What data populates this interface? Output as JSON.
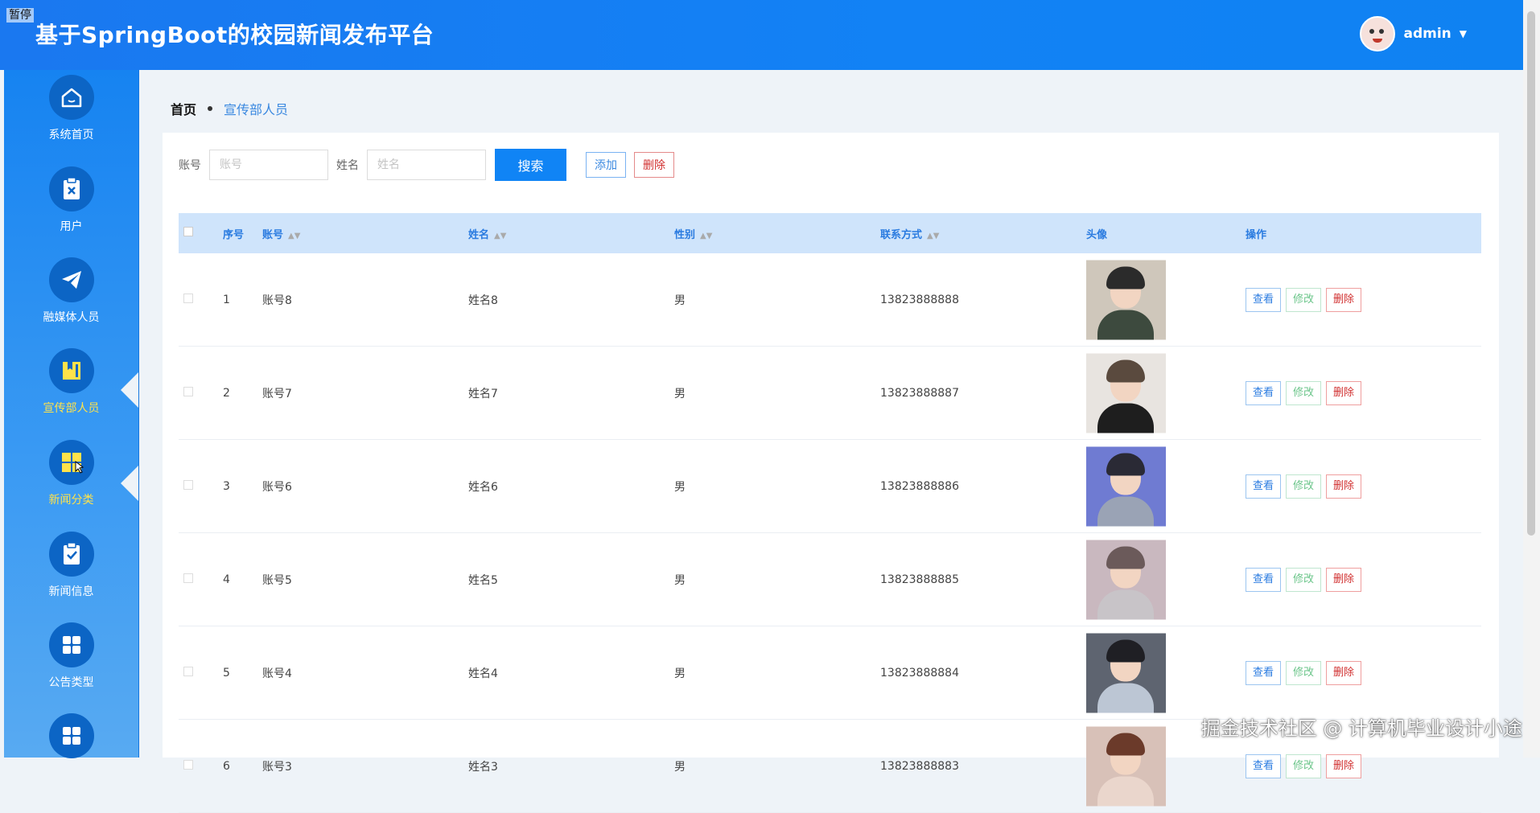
{
  "header": {
    "corner_tag": "暂停",
    "title": "基于SpringBoot的校园新闻发布平台",
    "user": "admin",
    "caret": "▼"
  },
  "sidebar": {
    "items": [
      {
        "label": "系统首页",
        "icon": "home-icon"
      },
      {
        "label": "用户",
        "icon": "clipboard-x-icon"
      },
      {
        "label": "融媒体人员",
        "icon": "paper-plane-icon"
      },
      {
        "label": "宣传部人员",
        "icon": "book-icon"
      },
      {
        "label": "新闻分类",
        "icon": "grid-icon"
      },
      {
        "label": "新闻信息",
        "icon": "clipboard-check-icon"
      },
      {
        "label": "公告类型",
        "icon": "grid-icon"
      }
    ],
    "active_label_color": "#ffe24a"
  },
  "breadcrumb": {
    "home": "首页",
    "current": "宣传部人员"
  },
  "search": {
    "account_label": "账号",
    "account_placeholder": "账号",
    "name_label": "姓名",
    "name_placeholder": "姓名",
    "search_button": "搜索",
    "add_button": "添加",
    "delete_button": "删除"
  },
  "table": {
    "headers": {
      "index": "序号",
      "account": "账号",
      "name": "姓名",
      "gender": "性别",
      "contact": "联系方式",
      "avatar": "头像",
      "actions": "操作"
    },
    "rows": [
      {
        "index": "1",
        "account": "账号8",
        "name": "姓名8",
        "gender": "男",
        "contact": "13823888888"
      },
      {
        "index": "2",
        "account": "账号7",
        "name": "姓名7",
        "gender": "男",
        "contact": "13823888887"
      },
      {
        "index": "3",
        "account": "账号6",
        "name": "姓名6",
        "gender": "男",
        "contact": "13823888886"
      },
      {
        "index": "4",
        "account": "账号5",
        "name": "姓名5",
        "gender": "男",
        "contact": "13823888885"
      },
      {
        "index": "5",
        "account": "账号4",
        "name": "姓名4",
        "gender": "男",
        "contact": "13823888884"
      },
      {
        "index": "6",
        "account": "账号3",
        "name": "姓名3",
        "gender": "男",
        "contact": "13823888883"
      }
    ],
    "action_labels": {
      "view": "查看",
      "edit": "修改",
      "delete": "删除"
    }
  },
  "watermark": "掘金技术社区 @ 计算机毕业设计小途"
}
